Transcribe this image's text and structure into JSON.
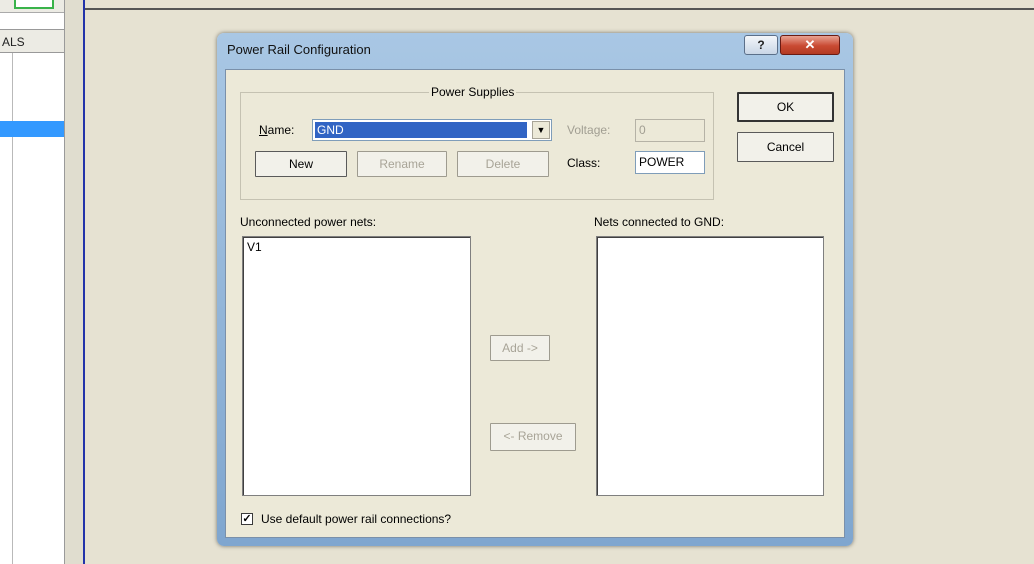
{
  "background": {
    "panel_header": "ALS"
  },
  "dialog": {
    "title": "Power Rail Configuration",
    "help_symbol": "?",
    "close_symbol": "✕",
    "power_supplies": {
      "group_label": "Power Supplies",
      "name_label": "Name:",
      "name_value": "GND",
      "voltage_label": "Voltage:",
      "voltage_value": "0",
      "class_label": "Class:",
      "class_value": "POWER",
      "new_button": "New",
      "rename_button": "Rename",
      "delete_button": "Delete"
    },
    "ok_button": "OK",
    "cancel_button": "Cancel",
    "unconnected_label": "Unconnected power nets:",
    "unconnected_items": [
      "V1"
    ],
    "connected_label": "Nets connected to GND:",
    "connected_items": [],
    "add_button": "Add ->",
    "remove_button": "<- Remove",
    "use_default_label": "Use default power rail connections?",
    "use_default_checked": true
  },
  "colors": {
    "selection": "#3164c4",
    "dialog_face": "#ece9d8",
    "close_button": "#c94a32"
  }
}
